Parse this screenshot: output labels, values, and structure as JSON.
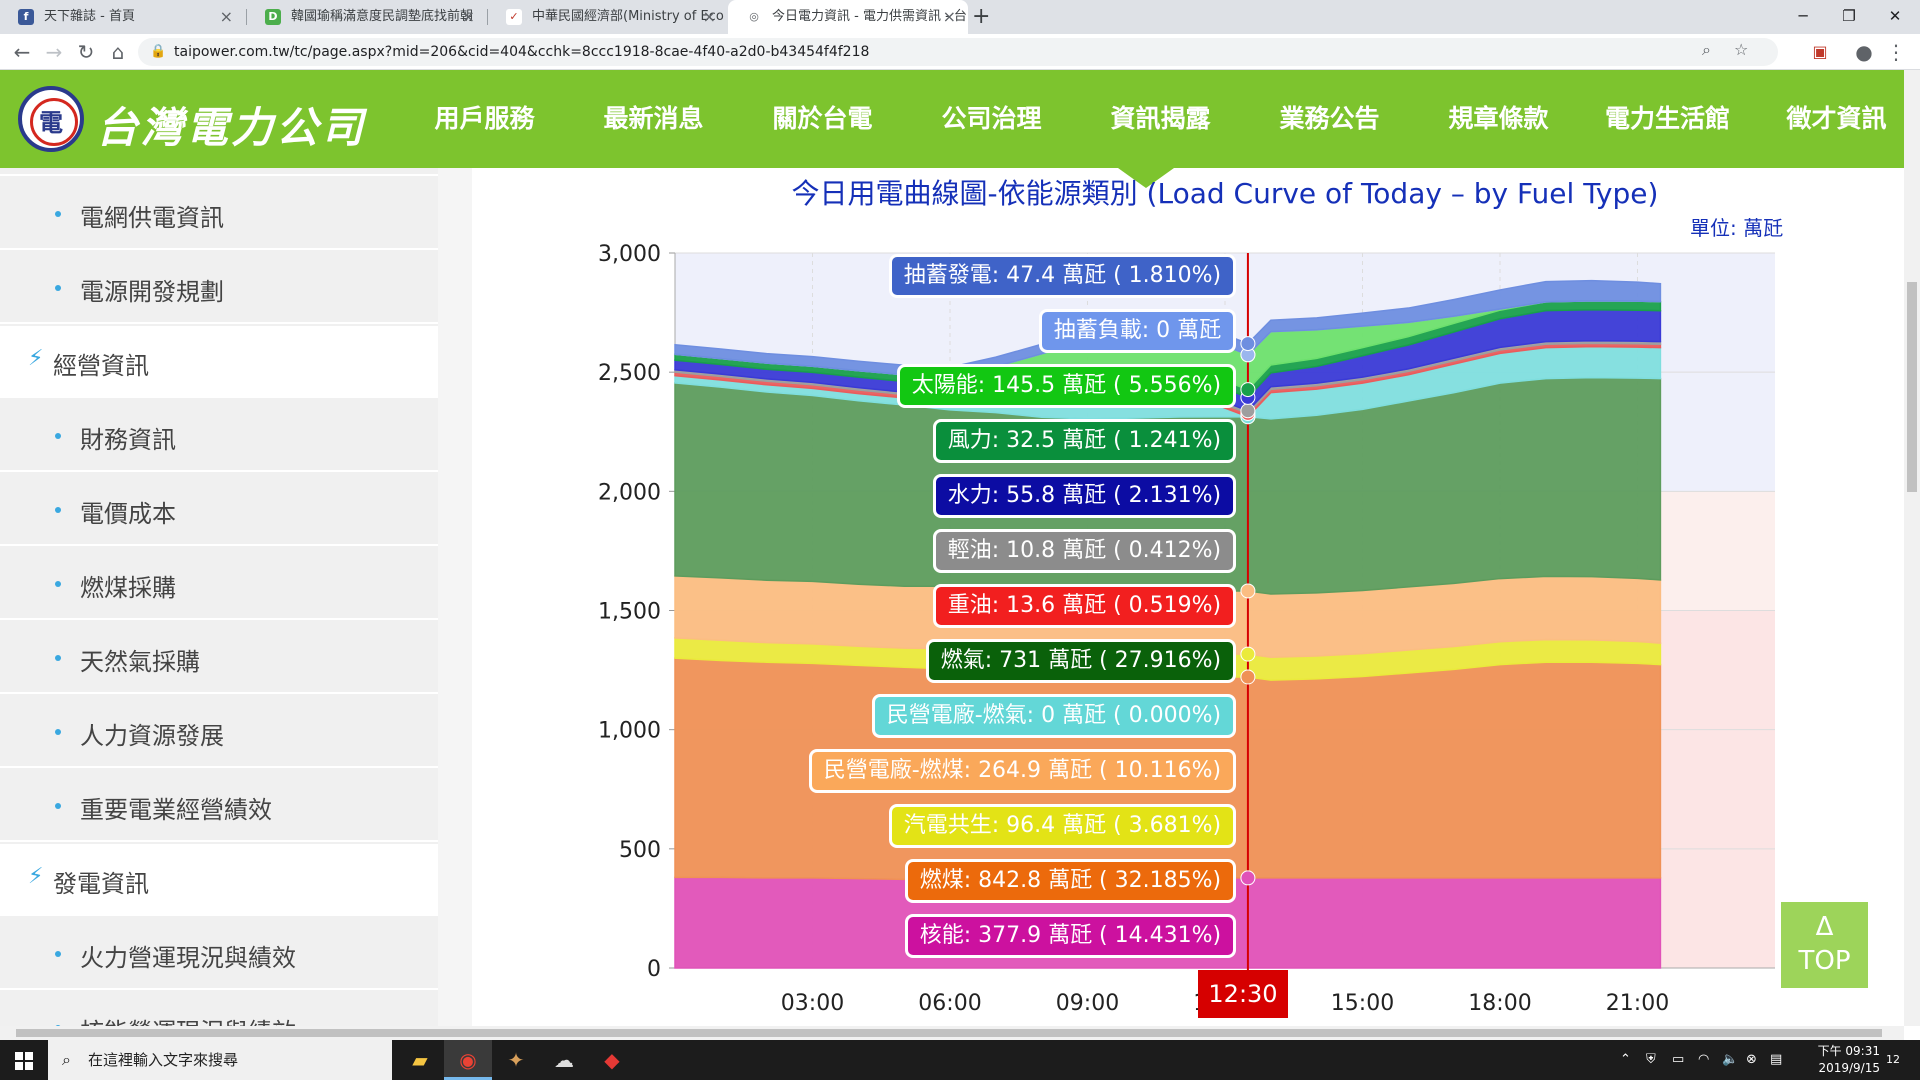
{
  "browser": {
    "tabs": [
      {
        "title": "天下雜誌 - 首頁",
        "icon": "facebook-icon",
        "color": "#3b5998",
        "glyph": "f"
      },
      {
        "title": "韓國瑜稱滿意度民調墊底找前朝",
        "icon": "news-icon",
        "color": "#4cae4c",
        "glyph": "D"
      },
      {
        "title": "中華民國經濟部(Ministry of Eco",
        "icon": "moea-icon",
        "color": "#c0392b",
        "glyph": "✓"
      },
      {
        "title": "今日電力資訊 - 電力供需資訊 - 台",
        "icon": "globe-icon",
        "color": "#5f6368",
        "glyph": "◎"
      }
    ],
    "new_tab": "+",
    "url": "taipower.com.tw/tc/page.aspx?mid=206&cid=404&cchk=8ccc1918-8cae-4f40-a2d0-b43454f4f218"
  },
  "site": {
    "logo": "台灣電力公司",
    "menu": [
      "用戶服務",
      "最新消息",
      "關於台電",
      "公司治理",
      "資訊揭露",
      "業務公告",
      "規章條款",
      "電力生活館",
      "徵才資訊"
    ]
  },
  "sidebar": {
    "items": [
      {
        "type": "sub",
        "label": "電網供電資訊"
      },
      {
        "type": "sub",
        "label": "電源開發規劃"
      },
      {
        "type": "cat",
        "label": "經營資訊"
      },
      {
        "type": "sub",
        "label": "財務資訊"
      },
      {
        "type": "sub",
        "label": "電價成本"
      },
      {
        "type": "sub",
        "label": "燃煤採購"
      },
      {
        "type": "sub",
        "label": "天然氣採購"
      },
      {
        "type": "sub",
        "label": "人力資源發展"
      },
      {
        "type": "sub",
        "label": "重要電業經營績效"
      },
      {
        "type": "cat",
        "label": "發電資訊"
      },
      {
        "type": "sub",
        "label": "火力營運現況與績效"
      },
      {
        "type": "sub",
        "label": "核能營運現況與績效"
      }
    ]
  },
  "chart_data": {
    "type": "area",
    "title": "今日用電曲線圖-依能源類別 (Load Curve of Today – by Fuel Type)",
    "unit": "單位: 萬瓩",
    "ylim": [
      0,
      3000
    ],
    "yticks": [
      "0",
      "500",
      "1,000",
      "1,500",
      "2,000",
      "2,500",
      "3,000"
    ],
    "xticks": [
      "03:00",
      "06:00",
      "09:00",
      "12:00",
      "15:00",
      "18:00",
      "21:00"
    ],
    "xlim": [
      0,
      24
    ],
    "x": [
      0,
      1,
      2,
      3,
      4,
      5,
      6,
      7,
      8,
      9,
      10,
      11,
      12.5,
      13,
      14,
      15,
      16,
      17,
      18,
      19,
      20,
      21,
      21.5
    ],
    "series": [
      {
        "name": "核能",
        "color": "#e052b8",
        "values": [
          380,
          380,
          378,
          378,
          375,
          372,
          370,
          372,
          375,
          376,
          377,
          378,
          378,
          378,
          378,
          378,
          378,
          378,
          378,
          378,
          378,
          378,
          378
        ]
      },
      {
        "name": "燃煤",
        "color": "#ef9156",
        "values": [
          920,
          910,
          905,
          900,
          895,
          890,
          885,
          875,
          860,
          850,
          845,
          843,
          843,
          830,
          835,
          845,
          860,
          875,
          895,
          905,
          905,
          900,
          895
        ]
      },
      {
        "name": "汽電共生",
        "color": "#eaea3c",
        "values": [
          85,
          85,
          82,
          82,
          80,
          80,
          85,
          90,
          92,
          94,
          95,
          96,
          96,
          96,
          96,
          96,
          96,
          96,
          96,
          95,
          94,
          92,
          90
        ]
      },
      {
        "name": "民營電廠-燃煤",
        "color": "#fbbd82",
        "values": [
          260,
          262,
          262,
          262,
          260,
          260,
          262,
          263,
          264,
          264,
          265,
          265,
          265,
          265,
          265,
          265,
          265,
          265,
          265,
          265,
          265,
          265,
          265
        ]
      },
      {
        "name": "燃氣",
        "color": "#5d9c5d",
        "values": [
          810,
          800,
          790,
          780,
          770,
          760,
          740,
          730,
          720,
          720,
          725,
          730,
          731,
          735,
          745,
          760,
          780,
          800,
          820,
          830,
          835,
          840,
          845
        ]
      },
      {
        "name": "民營電廠-燃氣",
        "color": "#7fdede",
        "values": [
          30,
          30,
          30,
          30,
          30,
          30,
          30,
          40,
          60,
          90,
          110,
          110,
          0,
          110,
          110,
          110,
          110,
          120,
          125,
          130,
          130,
          130,
          130
        ]
      },
      {
        "name": "重油",
        "color": "#ea5c5c",
        "values": [
          15,
          15,
          15,
          15,
          15,
          14,
          14,
          14,
          14,
          14,
          14,
          14,
          14,
          14,
          14,
          14,
          14,
          14,
          14,
          14,
          14,
          14,
          14
        ]
      },
      {
        "name": "輕油",
        "color": "#9e9e9e",
        "values": [
          10,
          10,
          10,
          10,
          10,
          10,
          10,
          10,
          10,
          10,
          10,
          11,
          11,
          11,
          11,
          11,
          11,
          11,
          11,
          11,
          11,
          11,
          11
        ]
      },
      {
        "name": "水力",
        "color": "#3a3ad6",
        "values": [
          40,
          40,
          40,
          42,
          44,
          45,
          46,
          50,
          52,
          54,
          55,
          56,
          56,
          58,
          70,
          90,
          100,
          110,
          120,
          130,
          130,
          130,
          130
        ]
      },
      {
        "name": "風力",
        "color": "#19a04b",
        "values": [
          25,
          25,
          26,
          26,
          27,
          28,
          28,
          29,
          30,
          31,
          32,
          32,
          33,
          33,
          34,
          34,
          35,
          36,
          36,
          37,
          37,
          38,
          38
        ]
      },
      {
        "name": "太陽能",
        "color": "#6de06d",
        "values": [
          0,
          0,
          0,
          0,
          0,
          0,
          10,
          50,
          100,
          130,
          145,
          150,
          146,
          140,
          120,
          90,
          60,
          30,
          5,
          0,
          0,
          0,
          0
        ]
      },
      {
        "name": "抽蓄負載",
        "color": "#9ab6ee",
        "values": [
          0,
          0,
          0,
          0,
          0,
          0,
          0,
          0,
          0,
          0,
          0,
          0,
          0,
          0,
          0,
          0,
          0,
          0,
          0,
          0,
          0,
          0,
          0
        ]
      },
      {
        "name": "抽蓄發電",
        "color": "#6e8ee0",
        "values": [
          40,
          40,
          40,
          40,
          40,
          40,
          40,
          40,
          40,
          42,
          45,
          47,
          47,
          48,
          50,
          55,
          60,
          70,
          80,
          85,
          85,
          80,
          75
        ]
      }
    ],
    "cursor_x": 12.5,
    "cursor_label": "12:30",
    "tooltips": [
      {
        "text": "抽蓄發電: 47.4 萬瓩 ( 1.810%)",
        "color": "#3f63c8"
      },
      {
        "text": "抽蓄負載: 0 萬瓩",
        "color": "#6f96ec"
      },
      {
        "text": "太陽能: 145.5 萬瓩 ( 5.556%)",
        "color": "#12c712"
      },
      {
        "text": "風力: 32.5 萬瓩 ( 1.241%)",
        "color": "#0a8f3c"
      },
      {
        "text": "水力: 55.8 萬瓩 ( 2.131%)",
        "color": "#0c0ca3"
      },
      {
        "text": "輕油: 10.8 萬瓩 ( 0.412%)",
        "color": "#8c8c8c"
      },
      {
        "text": "重油: 13.6 萬瓩 ( 0.519%)",
        "color": "#f21f1f"
      },
      {
        "text": "燃氣: 731 萬瓩 ( 27.916%)",
        "color": "#0a610a"
      },
      {
        "text": "民營電廠-燃氣: 0 萬瓩 ( 0.000%)",
        "color": "#63d7d7"
      },
      {
        "text": "民營電廠-燃煤: 264.9 萬瓩 ( 10.116%)",
        "color": "#faa85a"
      },
      {
        "text": "汽電共生: 96.4 萬瓩 ( 3.681%)",
        "color": "#e3e316"
      },
      {
        "text": "燃煤: 842.8 萬瓩 ( 32.185%)",
        "color": "#ec6a0c"
      },
      {
        "text": "核能: 377.9 萬瓩 ( 14.431%)",
        "color": "#cc119f"
      }
    ]
  },
  "top_button": {
    "arrow": "Δ",
    "label": "TOP"
  },
  "taskbar": {
    "search_placeholder": "在這裡輸入文字來搜尋",
    "time": "下午 09:31",
    "date": "2019/9/15",
    "notifications": "12"
  }
}
